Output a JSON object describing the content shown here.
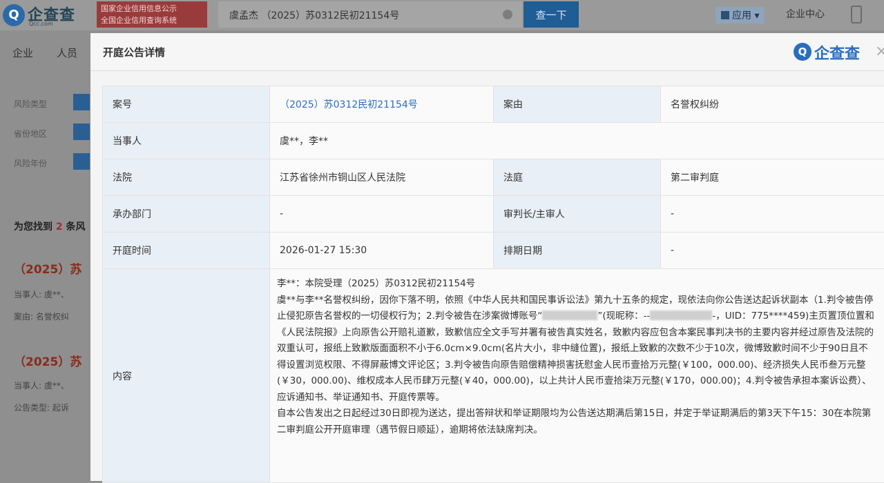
{
  "topbar": {
    "logo_text": "企查查",
    "logo_sub": "Qcc.com",
    "logo_glyph": "Q",
    "slogan_line1": "国家企业信用信息公示",
    "slogan_line2": "全国企业信用查询系统",
    "search_value": "虞孟杰 （2025）苏0312民初21154号",
    "search_button": "查一下",
    "apps_label": "应用",
    "enterprise_center": "企业中心"
  },
  "nav": {
    "items": [
      "企业",
      "人员"
    ]
  },
  "filters": [
    {
      "label": "风险类型"
    },
    {
      "label": "省份地区"
    },
    {
      "label": "风险年份"
    }
  ],
  "results": {
    "found_prefix": "为您找到",
    "found_count": "2",
    "found_suffix": "条风",
    "cases": [
      {
        "title": "（2025）苏",
        "line1": "当事人:  虞**、",
        "line2": "案由:   名誉权纠"
      },
      {
        "title": "（2025）苏",
        "line1": "当事人:  虞**、",
        "line2": "公告类型:  起诉"
      }
    ]
  },
  "modal": {
    "title": "开庭公告详情",
    "brand_glyph": "Q",
    "brand_text": "企查查",
    "close": "×",
    "rows": {
      "case_no_label": "案号",
      "case_no": "（2025）苏0312民初21154号",
      "cause_label": "案由",
      "cause": "名誉权纠纷",
      "parties_label": "当事人",
      "parties": "虞**，李**",
      "court_label": "法院",
      "court": "江苏省徐州市铜山区人民法院",
      "tribunal_label": "法庭",
      "tribunal": "第二审判庭",
      "dept_label": "承办部门",
      "dept": "-",
      "judge_label": "审判长/主审人",
      "judge": "-",
      "time_label": "开庭时间",
      "time": "2026-01-27 15:30",
      "schedule_label": "排期日期",
      "schedule": "-",
      "content_label": "内容",
      "content_p1": "李**：本院受理（2025）苏0312民初21154号",
      "content_p2a": "虞**与李**名誉权纠纷，因你下落不明，依照《中华人民共和国民事诉讼法》第九十五条的规定，现依法向你公告送达起诉状副本（1.判令被告停止侵犯原告名誉权的一切侵权行为；2.判令被告在涉案微博账号“",
      "content_p2b": "”(现昵称：--",
      "content_p2c": "-，UID：775****459)主页置顶位置和《人民法院报》上向原告公开赔礼道歉，致歉信应全文手写并署有被告真实姓名，致歉内容应包含本案民事判决书的主要内容并经过原告及法院的双重认可，报纸上致歉版面面积不小于6.0cm×9.0cm(名片大小，非中缝位置)，报纸上致歉的次数不少于10次，微博致歉时间不少于90日且不得设置浏览权限、不得屏蔽博文评论区；3.判令被告向原告赔偿精神损害抚慰金人民币壹拾万元整(￥100，000.00)、经济损失人民币叁万元整(￥30，000.00)、维权成本人民币肆万元整(￥40，000.00)，以上共计人民币壹拾柒万元整(￥170，000.00)；4.判令被告承担本案诉讼费）、应诉通知书、举证通知书、开庭传票等。",
      "content_p3": "自本公告发出之日起经过30日即视为送达，提出答辩状和举证期限均为公告送达期满后第15日，并定于举证期满后的第3天下午15：30在本院第二审判庭公开开庭审理（遇节假日顺延），逾期将依法缺席判决。"
    }
  }
}
